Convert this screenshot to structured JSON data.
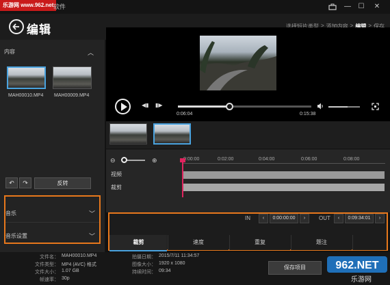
{
  "watermark": "乐游网 www.962.net",
  "app_title": "软件",
  "window_controls": {
    "toolbox": "toolbox-icon",
    "minimize": "—",
    "maximize": "☐",
    "close": "✕"
  },
  "header": {
    "title": "编辑",
    "steps": [
      "选择短片类型",
      "添加内容",
      "编辑",
      "保存"
    ],
    "step_separator": ">",
    "current_step": 2
  },
  "content_panel": {
    "label": "内容",
    "items": [
      {
        "name": "MAH00010.MP4",
        "selected": true
      },
      {
        "name": "MAH00009.MP4",
        "selected": false
      }
    ],
    "reverse_label": "反转"
  },
  "audio_panel": {
    "music_label": "音乐",
    "music_settings_label": "音乐设置"
  },
  "player": {
    "current_time": "0:06:04",
    "duration": "0:15:38",
    "progress": 0.39,
    "volume": 0.6
  },
  "timeline": {
    "ticks": [
      "0:00:00",
      "0:02:00",
      "0:04:00",
      "0:06:00",
      "0:08:00"
    ],
    "tracks": [
      "视频",
      "裁剪"
    ]
  },
  "edit": {
    "in_label": "IN",
    "in_value": "0:00:00:00",
    "out_label": "OUT",
    "out_value": "0:09:34:01",
    "tabs": [
      "裁剪",
      "速度",
      "重复",
      "题注"
    ],
    "selected_tab": 0
  },
  "file_info": {
    "filename_label": "文件名：",
    "filename": "MAH00010.MP4",
    "type_label": "文件类型：",
    "type": "MP4 (AVC) 格式",
    "size_label": "文件大小：",
    "size": "1.07 GB",
    "fps_label": "帧速率：",
    "fps": "30p",
    "date_label": "拍摄日期：",
    "date": "2015/7/11 11:34:57",
    "resolution_label": "图像大小：",
    "resolution": "1920 x 1080",
    "length_label": "持续时间：",
    "length": "09:34"
  },
  "save_label": "保存项目",
  "logo": {
    "text": "962.NET",
    "subtext": "乐游网"
  },
  "colors": {
    "accent": "#4aa3df",
    "highlight_box": "#e8781c",
    "playhead": "#e0245e"
  }
}
